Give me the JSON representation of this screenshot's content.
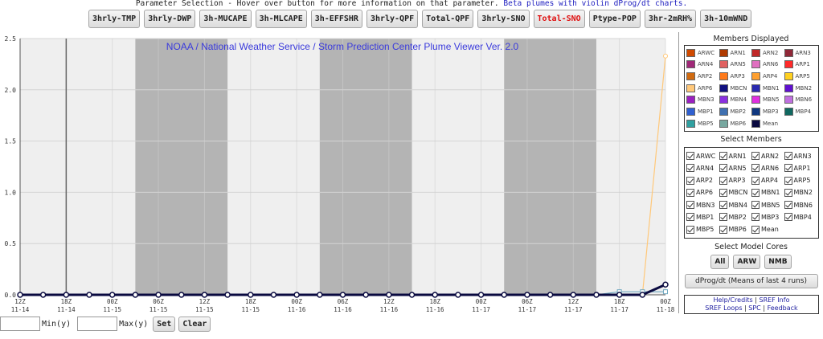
{
  "header": {
    "prefix": "Parameter Selection - Hover over button for more information on that parameter.",
    "beta_link": "Beta plumes with violin dProg/dt charts."
  },
  "parameters": [
    {
      "label": "3hrly-TMP",
      "active": false
    },
    {
      "label": "3hrly-DWP",
      "active": false
    },
    {
      "label": "3h-MUCAPE",
      "active": false
    },
    {
      "label": "3h-MLCAPE",
      "active": false
    },
    {
      "label": "3h-EFFSHR",
      "active": false
    },
    {
      "label": "3hrly-QPF",
      "active": false
    },
    {
      "label": "Total-QPF",
      "active": false
    },
    {
      "label": "3hrly-SNO",
      "active": false
    },
    {
      "label": "Total-SNO",
      "active": true
    },
    {
      "label": "Ptype-POP",
      "active": false
    },
    {
      "label": "3hr-2mRH%",
      "active": false
    },
    {
      "label": "3h-10mWND",
      "active": false
    }
  ],
  "colors": {
    "accent_active": "#e01010",
    "title_blue": "#3a3adc",
    "mean_line": "#0a0a40",
    "night_shade": "#b4b4b4",
    "plot_bg": "#efefef",
    "arp6_line": "#ffc87a"
  },
  "chart_data": {
    "type": "line",
    "title": "NOAA / National Weather Service / Storm Prediction Center Plume Viewer Ver. 2.0",
    "ylim": [
      0,
      2.5
    ],
    "yticks": [
      "0.0",
      "0.5",
      "1.0",
      "1.5",
      "2.0",
      "2.5"
    ],
    "xticks": [
      {
        "hour": "12Z",
        "date": "11-14"
      },
      {
        "hour": "18Z",
        "date": "11-14"
      },
      {
        "hour": "00Z",
        "date": "11-15"
      },
      {
        "hour": "06Z",
        "date": "11-15"
      },
      {
        "hour": "12Z",
        "date": "11-15"
      },
      {
        "hour": "18Z",
        "date": "11-15"
      },
      {
        "hour": "00Z",
        "date": "11-16"
      },
      {
        "hour": "06Z",
        "date": "11-16"
      },
      {
        "hour": "12Z",
        "date": "11-16"
      },
      {
        "hour": "18Z",
        "date": "11-16"
      },
      {
        "hour": "00Z",
        "date": "11-17"
      },
      {
        "hour": "06Z",
        "date": "11-17"
      },
      {
        "hour": "12Z",
        "date": "11-17"
      },
      {
        "hour": "18Z",
        "date": "11-17"
      },
      {
        "hour": "00Z",
        "date": "11-18"
      }
    ],
    "x_count": 29,
    "current_time_index": 2,
    "night_bands": [
      [
        5,
        9
      ],
      [
        13,
        17
      ],
      [
        21,
        25
      ]
    ],
    "grid": true,
    "series": [
      {
        "name": "Mean",
        "color": "#0a0a40",
        "values": [
          0,
          0,
          0,
          0,
          0,
          0,
          0,
          0,
          0,
          0,
          0,
          0,
          0,
          0,
          0,
          0,
          0,
          0,
          0,
          0,
          0,
          0,
          0,
          0,
          0,
          0,
          0,
          0,
          0.1
        ]
      },
      {
        "name": "ARP6",
        "color": "#ffc87a",
        "values": [
          0,
          0,
          0,
          0,
          0,
          0,
          0,
          0,
          0,
          0,
          0,
          0,
          0,
          0,
          0,
          0,
          0,
          0,
          0,
          0,
          0,
          0,
          0,
          0,
          0,
          0,
          0,
          0,
          2.33
        ]
      },
      {
        "name": "MBP5",
        "color": "#70a8c0",
        "values": [
          0,
          0,
          0,
          0,
          0,
          0,
          0,
          0,
          0,
          0,
          0,
          0,
          0,
          0,
          0,
          0,
          0,
          0,
          0,
          0,
          0,
          0,
          0,
          0,
          0,
          0,
          0.03,
          0.03,
          0.03
        ]
      }
    ]
  },
  "sidebar": {
    "members_title": "Members Displayed",
    "legend": [
      {
        "name": "ARWC",
        "color": "#d04a00"
      },
      {
        "name": "ARN1",
        "color": "#b03a00"
      },
      {
        "name": "ARN2",
        "color": "#c02828"
      },
      {
        "name": "ARN3",
        "color": "#902838"
      },
      {
        "name": "ARN4",
        "color": "#a02878"
      },
      {
        "name": "ARN5",
        "color": "#e06060"
      },
      {
        "name": "ARN6",
        "color": "#e070c0"
      },
      {
        "name": "ARP1",
        "color": "#ff2a2a"
      },
      {
        "name": "ARP2",
        "color": "#d06a10"
      },
      {
        "name": "ARP3",
        "color": "#ff7a1a"
      },
      {
        "name": "ARP4",
        "color": "#ffa030"
      },
      {
        "name": "ARP5",
        "color": "#ffd020"
      },
      {
        "name": "ARP6",
        "color": "#ffc87a"
      },
      {
        "name": "MBCN",
        "color": "#101080"
      },
      {
        "name": "MBN1",
        "color": "#2a2ab0"
      },
      {
        "name": "MBN2",
        "color": "#6010d0"
      },
      {
        "name": "MBN3",
        "color": "#9a20c0"
      },
      {
        "name": "MBN4",
        "color": "#8a30e0"
      },
      {
        "name": "MBN5",
        "color": "#e030e0"
      },
      {
        "name": "MBN6",
        "color": "#c070e0"
      },
      {
        "name": "MBP1",
        "color": "#3060d0"
      },
      {
        "name": "MBP2",
        "color": "#4070b0"
      },
      {
        "name": "MBP3",
        "color": "#103880"
      },
      {
        "name": "MBP4",
        "color": "#106860"
      },
      {
        "name": "MBP5",
        "color": "#30a0a0"
      },
      {
        "name": "MBP6",
        "color": "#78a8a0"
      },
      {
        "name": "Mean",
        "color": "#0a0a40"
      }
    ],
    "select_title": "Select Members",
    "select_members": [
      "ARWC",
      "ARN1",
      "ARN2",
      "ARN3",
      "ARN4",
      "ARN5",
      "ARN6",
      "ARP1",
      "ARP2",
      "ARP3",
      "ARP4",
      "ARP5",
      "ARP6",
      "MBCN",
      "MBN1",
      "MBN2",
      "MBN3",
      "MBN4",
      "MBN5",
      "MBN6",
      "MBP1",
      "MBP2",
      "MBP3",
      "MBP4",
      "MBP5",
      "MBP6",
      "Mean"
    ],
    "cores_title": "Select Model Cores",
    "cores": [
      "All",
      "ARW",
      "NMB"
    ],
    "dprog_label": "dProg/dt (Means of last 4 runs)",
    "links": {
      "help": "Help/Credits",
      "sref_info": "SREF Info",
      "sref_loops": "SREF Loops",
      "spc": "SPC",
      "feedback": "Feedback"
    }
  },
  "bottom": {
    "min_label": "Min(y)",
    "max_label": "Max(y)",
    "set_label": "Set",
    "clear_label": "Clear",
    "min_value": "",
    "max_value": ""
  }
}
